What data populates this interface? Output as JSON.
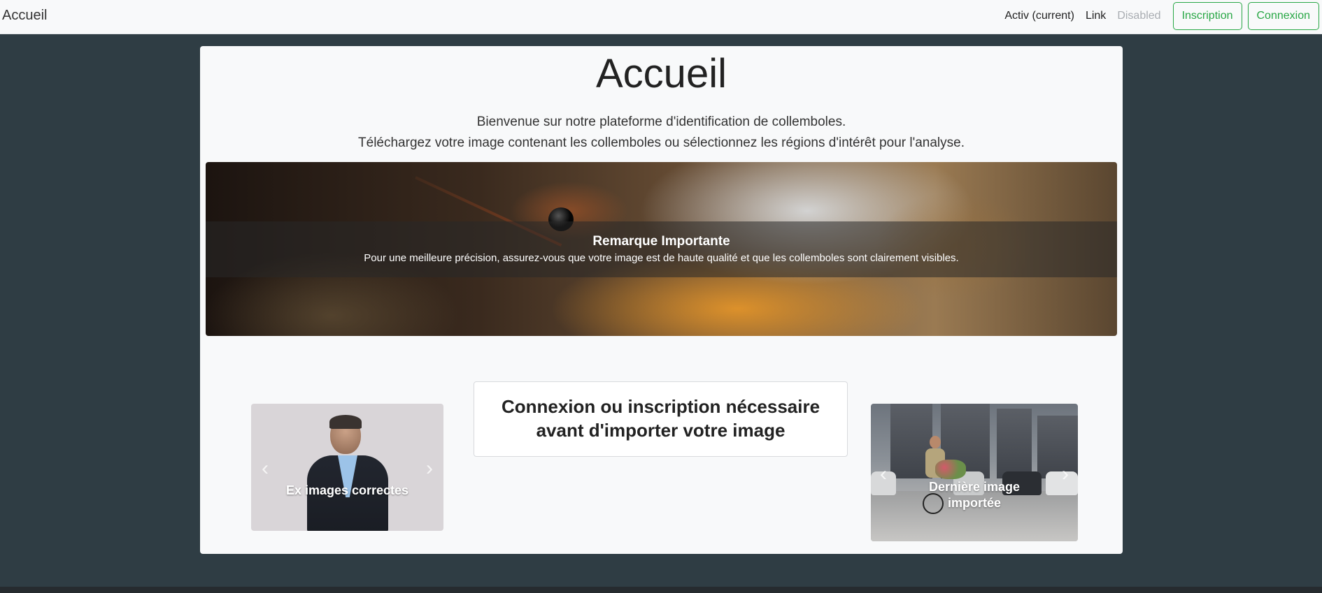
{
  "navbar": {
    "brand": "Accueil",
    "links": [
      {
        "label": "Activ (current)",
        "state": "active"
      },
      {
        "label": "Link",
        "state": "normal"
      },
      {
        "label": "Disabled",
        "state": "disabled"
      }
    ],
    "register_label": "Inscription",
    "login_label": "Connexion"
  },
  "main": {
    "title": "Accueil",
    "intro_line1": "Bienvenue sur notre plateforme d'identification de collemboles.",
    "intro_line2": "Téléchargez votre image contenant les collemboles ou sélectionnez les régions d'intérêt pour l'analyse.",
    "hero": {
      "caption_title": "Remarque Importante",
      "caption_text": "Pour une meilleure précision, assurez-vous que votre image est de haute qualité et que les collemboles sont clairement visibles."
    },
    "left_carousel": {
      "caption": "Ex images correctes"
    },
    "login_prompt": {
      "line1": "Connexion ou inscription nécessaire",
      "line2": "avant d'importer votre image"
    },
    "right_carousel": {
      "caption_line1": "Dernière image",
      "caption_line2": "importée"
    }
  },
  "colors": {
    "accent": "#28a745",
    "page_background": "#2f3d44",
    "card_background": "#f8f9fa"
  },
  "icons": {
    "prev": "chevron-left-icon",
    "next": "chevron-right-icon"
  }
}
